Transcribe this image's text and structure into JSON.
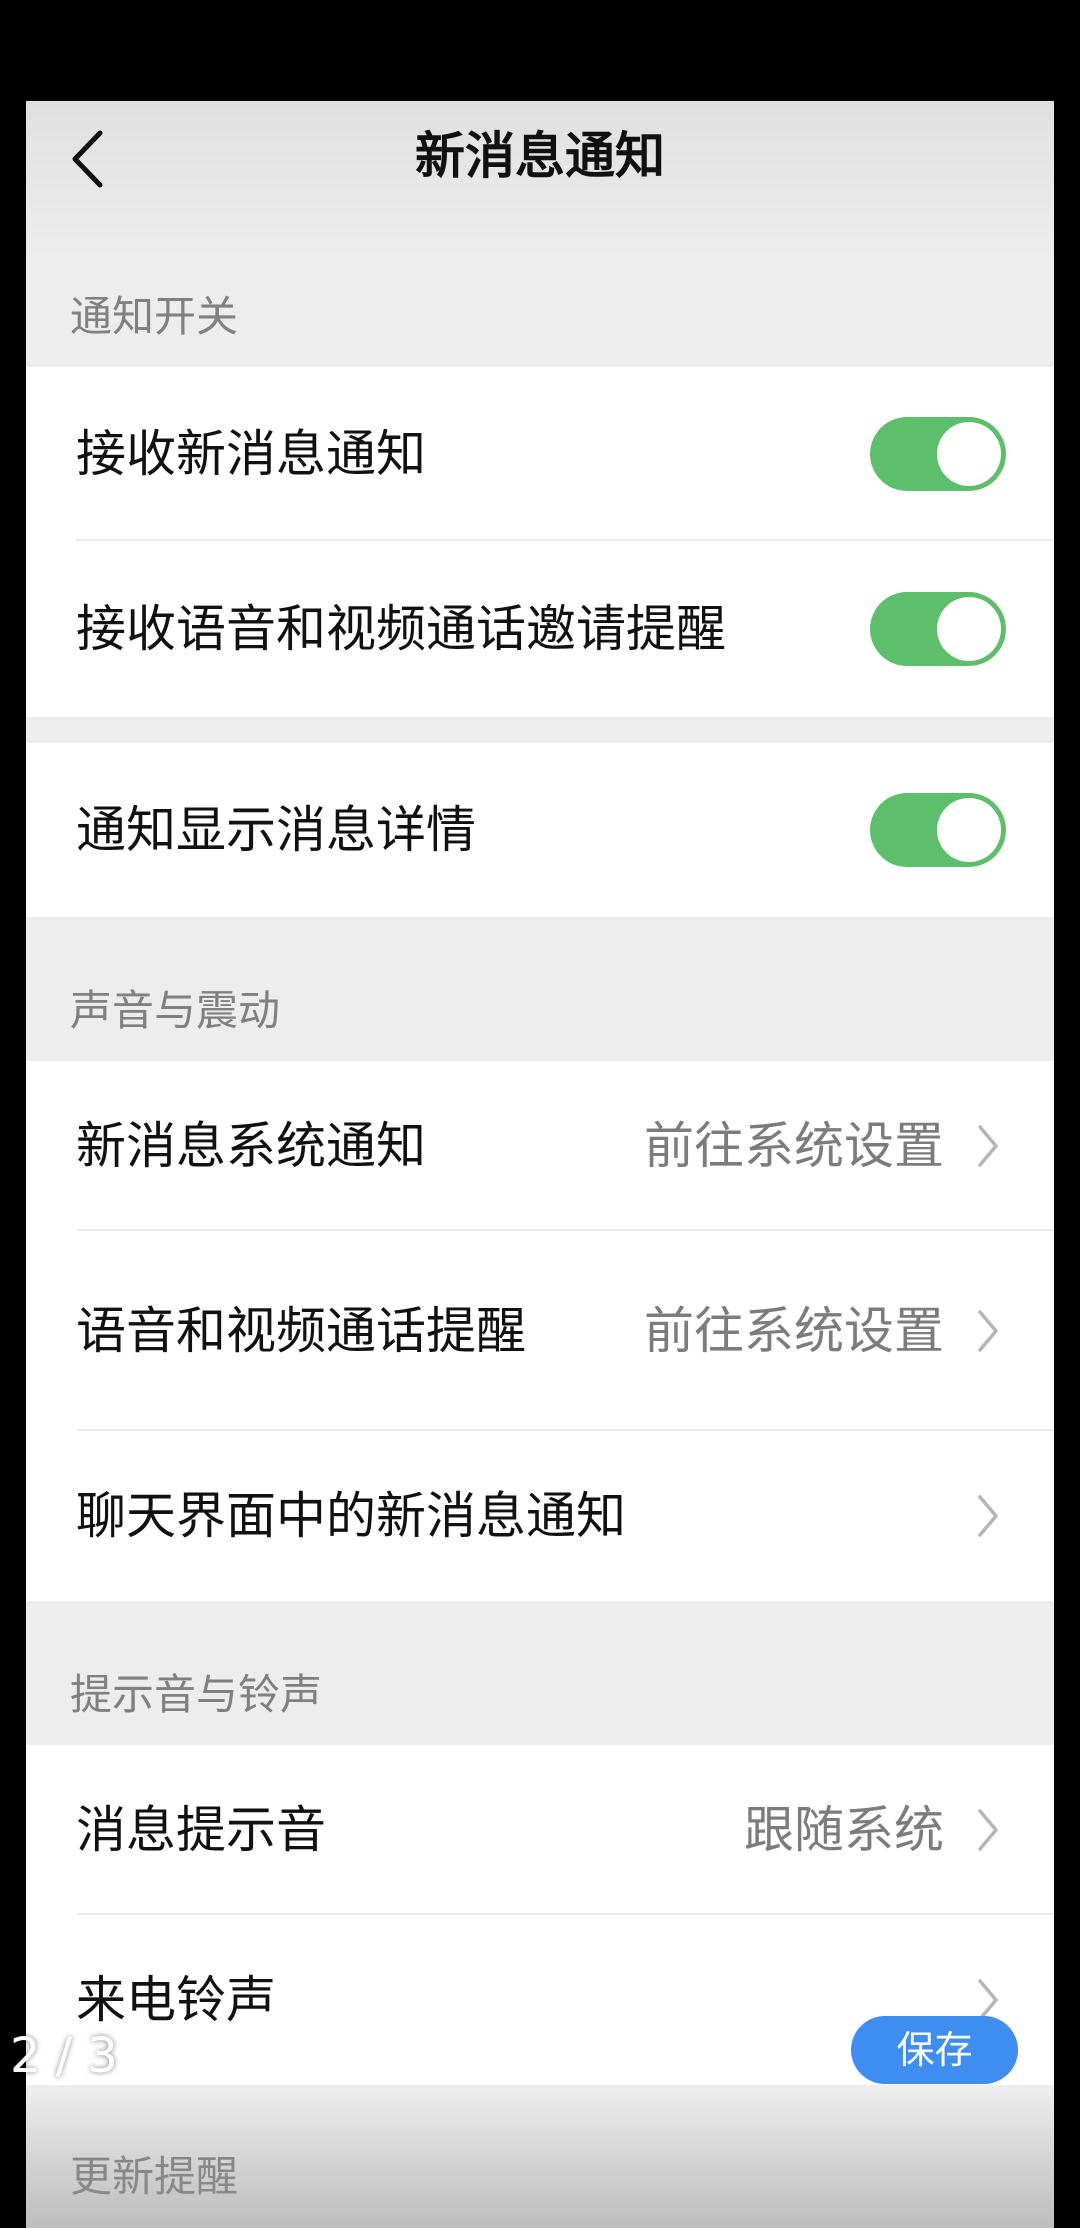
{
  "colors": {
    "accent_green": "#5dbf6b",
    "save_blue": "#3d8ef0",
    "page_bg": "#ededed"
  },
  "nav": {
    "title": "新消息通知",
    "back_icon": "chevron-left-icon"
  },
  "sections": [
    {
      "header": "通知开关",
      "groups": [
        {
          "rows": [
            {
              "label": "接收新消息通知",
              "toggle_on": true
            },
            {
              "label": "接收语音和视频通话邀请提醒",
              "toggle_on": true
            }
          ]
        },
        {
          "rows": [
            {
              "label": "通知显示消息详情",
              "toggle_on": true
            }
          ]
        }
      ]
    },
    {
      "header": "声音与震动",
      "rows": [
        {
          "label": "新消息系统通知",
          "value": "前往系统设置"
        },
        {
          "label": "语音和视频通话提醒",
          "value": "前往系统设置"
        },
        {
          "label": "聊天界面中的新消息通知",
          "value": ""
        }
      ]
    },
    {
      "header": "提示音与铃声",
      "rows": [
        {
          "label": "消息提示音",
          "value": "跟随系统"
        },
        {
          "label": "来电铃声",
          "value": ""
        }
      ]
    },
    {
      "header": "更新提醒"
    }
  ],
  "overlay": {
    "page_counter": "2 / 3",
    "save_label": "保存"
  }
}
